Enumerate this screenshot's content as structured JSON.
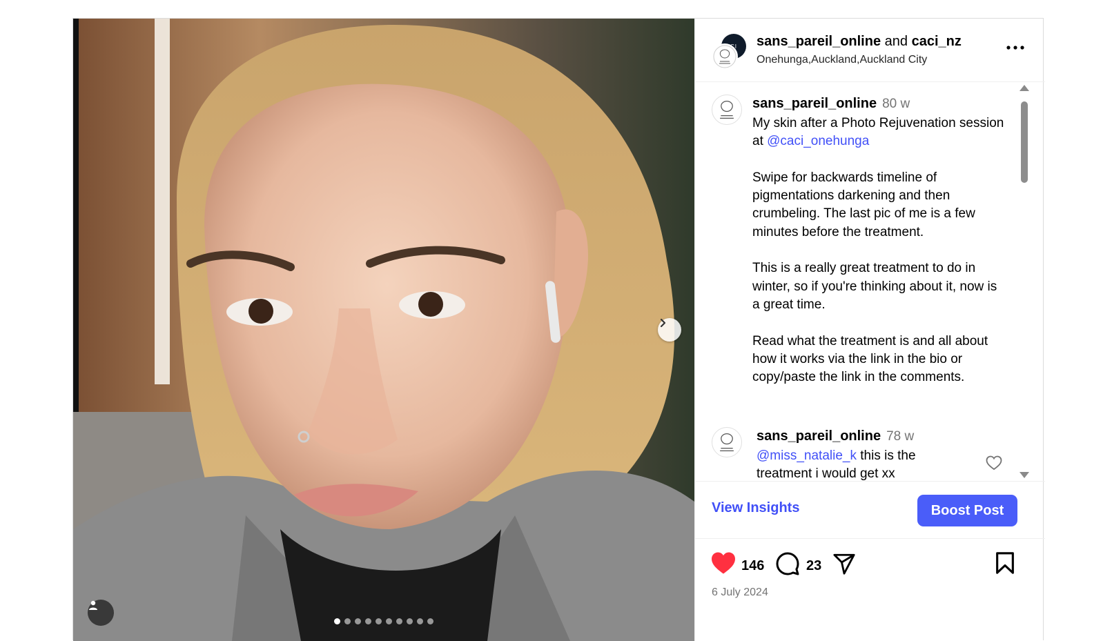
{
  "header": {
    "user1": "sans_pareil_online",
    "conjunction": "and",
    "user2": "caci_nz",
    "location": "Onehunga,Auckland,Auckland City",
    "collab_avatar_text": "CI"
  },
  "caption": {
    "username": "sans_pareil_online",
    "time": "80 w",
    "line1": "My skin after a Photo Rejuvenation session at ",
    "mention": "@caci_onehunga",
    "body": "\n\nSwipe for backwards timeline of pigmentations darkening and then crumbeling. The last pic of me is a few minutes before the treatment.\n\nThis is a really great treatment to do in winter, so if you're thinking about it, now is a great time.\n\nRead what the treatment is and all about how it works via the link in the bio or copy/paste the link in the comments."
  },
  "comment": {
    "username": "sans_pareil_online",
    "time": "78 w",
    "mention": "@miss_natalie_k",
    "text": " this is the treatment i would get xx"
  },
  "insights": {
    "view_insights": "View Insights",
    "boost_post": "Boost Post"
  },
  "actions": {
    "likes": "146",
    "comments": "23",
    "liked": true
  },
  "date": "6 July 2024",
  "carousel": {
    "slide_count": 10,
    "active_index": 0
  },
  "colors": {
    "accent": "#4150f7",
    "boost": "#4a5df9",
    "like": "#ff3040"
  }
}
